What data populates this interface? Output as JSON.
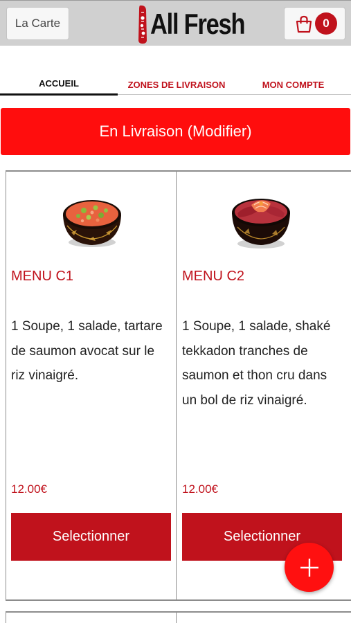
{
  "header": {
    "carte_label": "La Carte",
    "brand": "All Fresh",
    "cart_count": "0"
  },
  "tabs": [
    {
      "label": "ACCUEIL"
    },
    {
      "label": "ZONES DE LIVRAISON"
    },
    {
      "label": "MON COMPTE"
    }
  ],
  "delivery_label": "En Livraison (Modifier)",
  "menus": [
    {
      "title": "MENU C1",
      "description": "1 Soupe, 1 salade, tartare de saumon avocat sur le riz vinaigré.",
      "price": "12.00€",
      "button_label": "Selectionner",
      "image": "tartare-bowl-image"
    },
    {
      "title": "MENU C2",
      "description": "1 Soupe, 1 salade, shaké tekkadon tranches de saumon et thon cru dans un bol de riz vinaigré.",
      "price": "12.00€",
      "button_label": "Selectionner",
      "image": "tekkadon-bowl-image"
    }
  ],
  "colors": {
    "accent": "#c0121c",
    "banner": "#ff0d0d",
    "fab": "#ff1010"
  },
  "icons": {
    "cart": "shopping-bag-icon",
    "fab": "plus-icon"
  }
}
